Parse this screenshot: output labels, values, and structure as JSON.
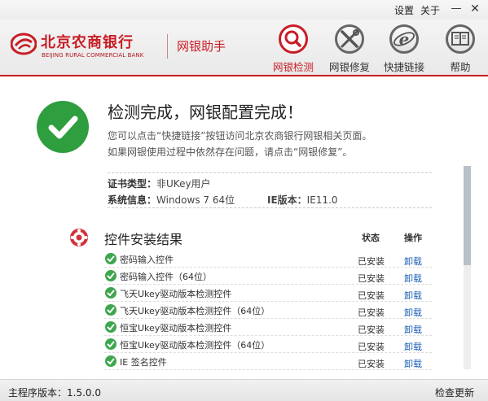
{
  "titlebar": {
    "settings": "设置",
    "about": "关于",
    "minimize": "—",
    "close": "✕"
  },
  "brand": {
    "name_cn": "北京农商银行",
    "name_en": "BEIJING RURAL COMMERCIAL BANK",
    "product": "网银助手",
    "color": "#c81d25"
  },
  "nav": [
    {
      "label": "网银检测",
      "icon": "magnifier-icon",
      "active": true
    },
    {
      "label": "网银修复",
      "icon": "wrench-screwdriver-icon",
      "active": false
    },
    {
      "label": "快捷链接",
      "icon": "ie-browser-icon",
      "active": false
    },
    {
      "label": "帮助",
      "icon": "book-icon",
      "active": false
    }
  ],
  "result": {
    "title": "检测完成，网银配置完成！",
    "line1": "您可以点击“快捷链接”按钮访问北京农商银行网银相关页面。",
    "line2": "如果网银使用过程中依然存在问题，请点击“网银修复”。"
  },
  "info": {
    "cert_label": "证书类型：",
    "cert_value": "非UKey用户",
    "sys_label": "系统信息：",
    "sys_value": "Windows 7 64位",
    "ie_label": "IE版本：",
    "ie_value": "IE11.0"
  },
  "controls": {
    "title": "控件安装结果",
    "col_status": "状态",
    "col_op": "操作",
    "rows": [
      {
        "name": "密码输入控件",
        "status": "已安装",
        "op": "卸载"
      },
      {
        "name": "密码输入控件（64位）",
        "status": "已安装",
        "op": "卸载"
      },
      {
        "name": "飞天Ukey驱动版本检测控件",
        "status": "已安装",
        "op": "卸载"
      },
      {
        "name": "飞天Ukey驱动版本检测控件（64位）",
        "status": "已安装",
        "op": "卸载"
      },
      {
        "name": "恒宝Ukey驱动版本检测控件",
        "status": "已安装",
        "op": "卸载"
      },
      {
        "name": "恒宝Ukey驱动版本检测控件（64位）",
        "status": "已安装",
        "op": "卸载"
      },
      {
        "name": "IE 签名控件",
        "status": "已安装",
        "op": "卸载"
      }
    ]
  },
  "footer": {
    "version": "主程序版本：1.5.0.0",
    "update": "检查更新"
  },
  "colors": {
    "success_green": "#2f9e3e",
    "link_blue": "#1a5fb4"
  }
}
